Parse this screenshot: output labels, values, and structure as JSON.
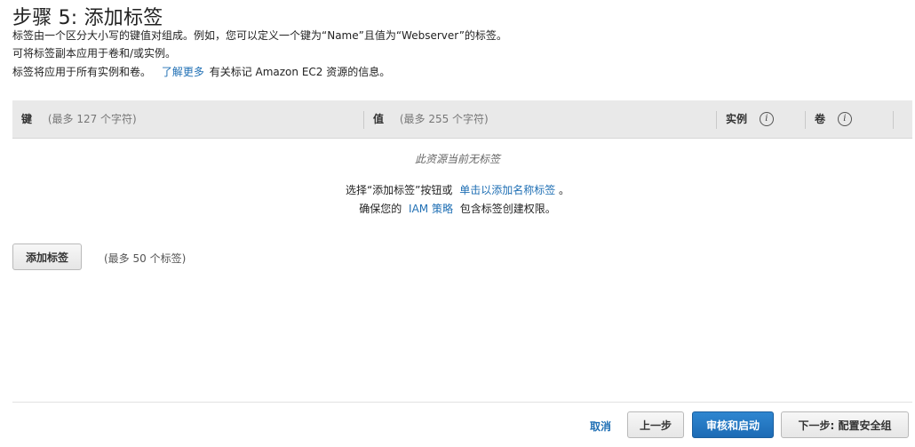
{
  "page": {
    "title": "步骤 5: 添加标签",
    "desc1": "标签由一个区分大小写的键值对组成。例如，您可以定义一个键为“Name”且值为“Webserver”的标签。",
    "desc2": "可将标签副本应用于卷和/或实例。",
    "desc3_prefix": "标签将应用于所有实例和卷。",
    "desc3_link": "了解更多",
    "desc3_suffix": "有关标记 Amazon EC2 资源的信息。"
  },
  "table": {
    "key_label": "键",
    "key_hint": "(最多 127 个字符)",
    "value_label": "值",
    "value_hint": "(最多 255 个字符)",
    "instance_label": "实例",
    "volume_label": "卷",
    "info_glyph": "i"
  },
  "empty": {
    "message": "此资源当前无标签",
    "line1_prefix": "选择“添加标签”按钮或",
    "line1_link": "单击以添加名称标签",
    "line1_suffix": "。",
    "line2_prefix": "确保您的",
    "line2_link": "IAM 策略",
    "line2_suffix": "包含标签创建权限。"
  },
  "add": {
    "button": "添加标签",
    "hint": "(最多 50 个标签)"
  },
  "footer": {
    "cancel": "取消",
    "previous": "上一步",
    "review": "审核和启动",
    "next": "下一步: 配置安全组"
  }
}
